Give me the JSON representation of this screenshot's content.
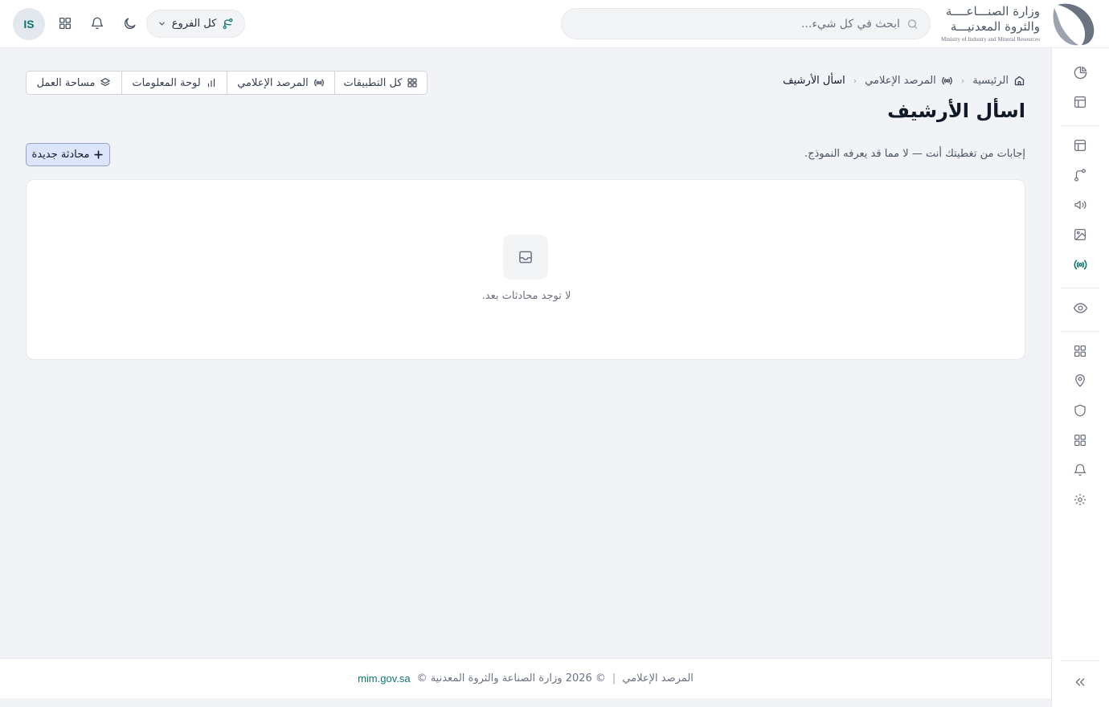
{
  "header": {
    "logo": {
      "line1": "وزارة الصنـــاعــــة",
      "line2": "والثروة المعدنيـــة",
      "line3": "Ministry of Industry and Mineral Resources"
    },
    "search": {
      "placeholder": "ابحث في كل شيء..."
    },
    "branch_selector": {
      "label": "كل الفروع"
    },
    "icons": [
      "moon-icon",
      "bell-icon",
      "apps-grid-icon"
    ],
    "avatar": {
      "initials": "IS"
    }
  },
  "breadcrumb": {
    "items": [
      {
        "label": "الرئيسية",
        "icon": "home-icon"
      },
      {
        "label": "المرصد الإعلامي",
        "icon": "broadcast-icon"
      },
      {
        "label": "اسأل الأرشيف"
      }
    ]
  },
  "page": {
    "title": "اسأل الأرشيف",
    "subtitle": "إجابات من تغطيتك أنت — لا مما قد يعرفه النموذج.",
    "new_chat_label": "محادثة جديدة",
    "empty_text": "لا توجد محادثات بعد."
  },
  "tabs": [
    {
      "label": "كل التطبيقات",
      "icon": "apps-grid-icon"
    },
    {
      "label": "المرصد الإعلامي",
      "icon": "broadcast-icon"
    },
    {
      "label": "لوحة المعلومات",
      "icon": "bar-chart-icon"
    },
    {
      "label": "مساحة العمل",
      "icon": "layers-icon"
    }
  ],
  "sidebar": {
    "items": [
      "pie-chart-icon",
      "layout-icon",
      "layout-icon",
      "branch-icon",
      "megaphone-icon",
      "image-icon",
      "broadcast-icon",
      "eye-icon",
      "apps-grid-icon",
      "map-pin-icon",
      "shield-icon",
      "apps-grid-icon",
      "bell-icon",
      "gear-icon",
      "collapse-icon"
    ],
    "active": "broadcast-icon"
  },
  "footer": {
    "app_name": "المرصد الإعلامي",
    "separator": "|",
    "copyright": "© 2026 وزارة الصناعة والثروة المعدنية ©",
    "link": "mim.gov.sa"
  },
  "colors": {
    "accent": "#0f766e",
    "button_bg": "#dce5fb",
    "page_bg": "#f1f3f6"
  }
}
